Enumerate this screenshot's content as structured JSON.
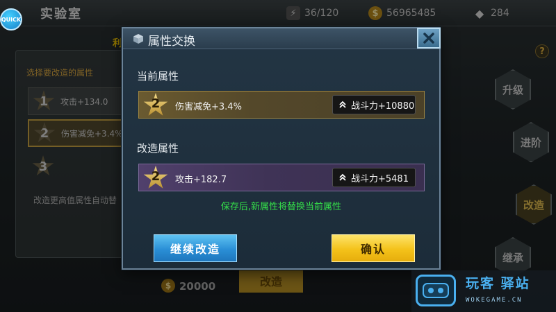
{
  "quick_button": "QUICK",
  "header": {
    "title": "实验室",
    "energy": "36/120",
    "gold": "56965485",
    "diamonds": "284"
  },
  "obstruct_label": "利",
  "left_panel": {
    "hint": "选择要改造的属性",
    "items": [
      {
        "star": "1",
        "label": "攻击+134.0"
      },
      {
        "star": "2",
        "label": "伤害减免+3.4%"
      },
      {
        "star": "3",
        "label": ""
      }
    ],
    "footer": "改造更高值属性自动替"
  },
  "side_buttons": {
    "upgrade": "升级",
    "advance": "进阶",
    "modify": "改造",
    "inherit": "继承",
    "help": "?"
  },
  "cost": {
    "value": "20000",
    "button": "改造"
  },
  "modal": {
    "title": "属性交换",
    "current_section": "当前属性",
    "current": {
      "star": "2",
      "attribute": "伤害减免+3.4%",
      "power": "战斗力+10880"
    },
    "modified_section": "改造属性",
    "modified": {
      "star": "2",
      "attribute": "攻击+182.7",
      "power": "战斗力+5481"
    },
    "note": "保存后,新属性将替换当前属性",
    "continue_button": "继续改造",
    "confirm_button": "确认"
  },
  "watermark": {
    "text": "玩客 驿站",
    "sub": "WOKEGAME.CN"
  },
  "colors": {
    "note_green": "#35e24a",
    "continue_blue": "#2a8fd6",
    "confirm_yellow": "#f4c21a",
    "gold_bar": "#54482a",
    "purple_bar": "#3f3356"
  }
}
